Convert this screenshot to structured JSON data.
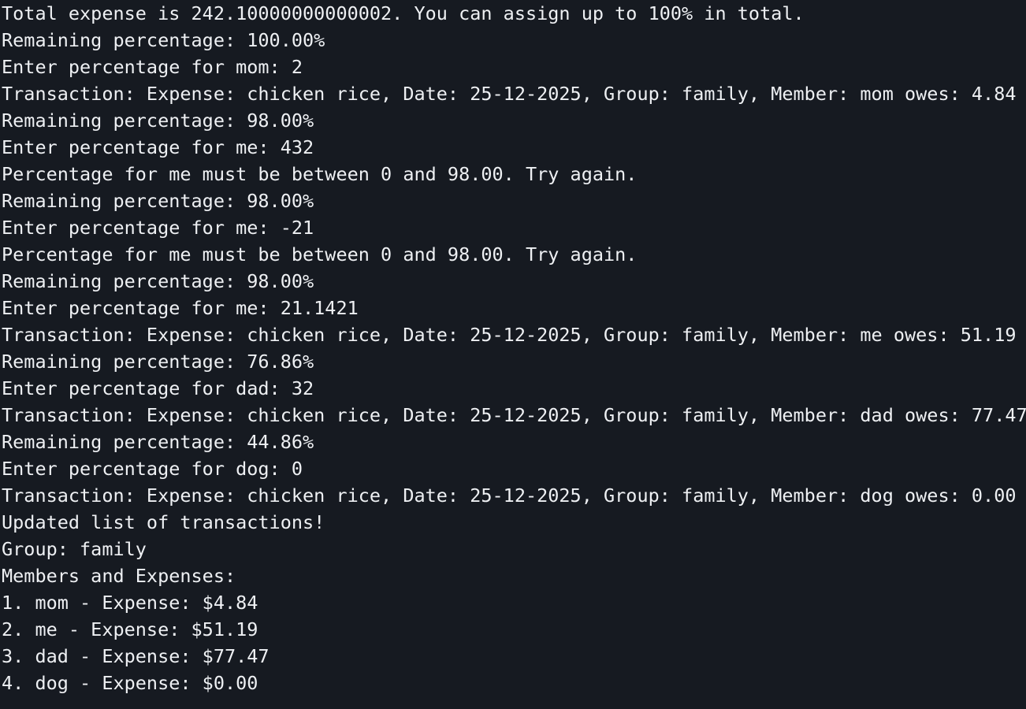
{
  "terminal": {
    "background": "#161a21",
    "foreground": "#eef0f3",
    "lines": [
      "Total expense is 242.10000000000002. You can assign up to 100% in total.",
      "Remaining percentage: 100.00%",
      "Enter percentage for mom: 2",
      "Transaction: Expense: chicken rice, Date: 25-12-2025, Group: family, Member: mom owes: 4.84",
      "Remaining percentage: 98.00%",
      "Enter percentage for me: 432",
      "Percentage for me must be between 0 and 98.00. Try again.",
      "Remaining percentage: 98.00%",
      "Enter percentage for me: -21",
      "Percentage for me must be between 0 and 98.00. Try again.",
      "Remaining percentage: 98.00%",
      "Enter percentage for me: 21.1421",
      "Transaction: Expense: chicken rice, Date: 25-12-2025, Group: family, Member: me owes: 51.19",
      "Remaining percentage: 76.86%",
      "Enter percentage for dad: 32",
      "Transaction: Expense: chicken rice, Date: 25-12-2025, Group: family, Member: dad owes: 77.47",
      "Remaining percentage: 44.86%",
      "Enter percentage for dog: 0",
      "Transaction: Expense: chicken rice, Date: 25-12-2025, Group: family, Member: dog owes: 0.00",
      "Updated list of transactions!",
      "Group: family",
      "Members and Expenses:",
      "1. mom - Expense: $4.84",
      "2. me - Expense: $51.19",
      "3. dad - Expense: $77.47",
      "4. dog - Expense: $0.00"
    ]
  }
}
